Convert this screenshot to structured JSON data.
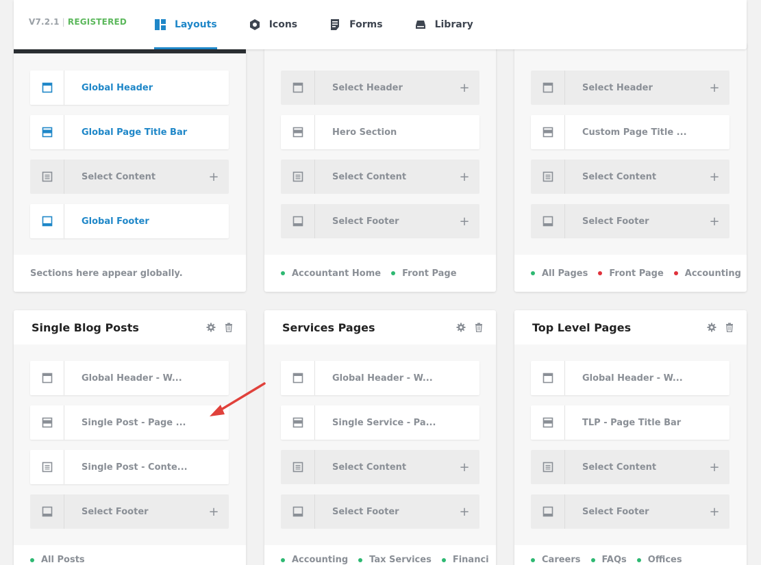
{
  "header": {
    "version": "V7.2.1",
    "separator": "|",
    "status": "REGISTERED",
    "nav": [
      {
        "label": "Layouts",
        "icon": "layouts-icon",
        "active": true
      },
      {
        "label": "Icons",
        "icon": "icons-icon",
        "active": false
      },
      {
        "label": "Forms",
        "icon": "forms-icon",
        "active": false
      },
      {
        "label": "Library",
        "icon": "library-icon",
        "active": false
      }
    ]
  },
  "cards": {
    "global": {
      "slots": [
        "Global Header",
        "Global Page Title Bar",
        "Select Content",
        "Global Footer"
      ],
      "footer": "Sections here appear globally."
    },
    "accountant": {
      "slots": [
        "Select Header",
        "Hero Section",
        "Select Content",
        "Select Footer"
      ],
      "tags": [
        "Accountant Home",
        "Front Page"
      ]
    },
    "third": {
      "slots": [
        "Select Header",
        "Custom Page Title ...",
        "Select Content",
        "Select Footer"
      ],
      "tags": [
        "All Pages",
        "Front Page",
        "Accounting"
      ]
    },
    "blog": {
      "title": "Single Blog Posts",
      "slots": [
        "Global Header - W...",
        "Single Post - Page ...",
        "Single Post - Conte...",
        "Select Footer"
      ],
      "tags": [
        "All Posts"
      ]
    },
    "services": {
      "title": "Services Pages",
      "slots": [
        "Global Header - W...",
        "Single Service - Pa...",
        "Select Content",
        "Select Footer"
      ],
      "tags": [
        "Accounting",
        "Tax Services",
        "Financi"
      ]
    },
    "toplevel": {
      "title": "Top Level Pages",
      "slots": [
        "Global Header - W...",
        "TLP - Page Title Bar",
        "Select Content",
        "Select Footer"
      ],
      "tags": [
        "Careers",
        "FAQs",
        "Offices"
      ]
    }
  },
  "colors": {
    "accent": "#1f87c8",
    "registered": "#5cb85c",
    "tag_green": "#2eb872",
    "tag_red": "#e0313b",
    "arrow": "#e0413b"
  }
}
